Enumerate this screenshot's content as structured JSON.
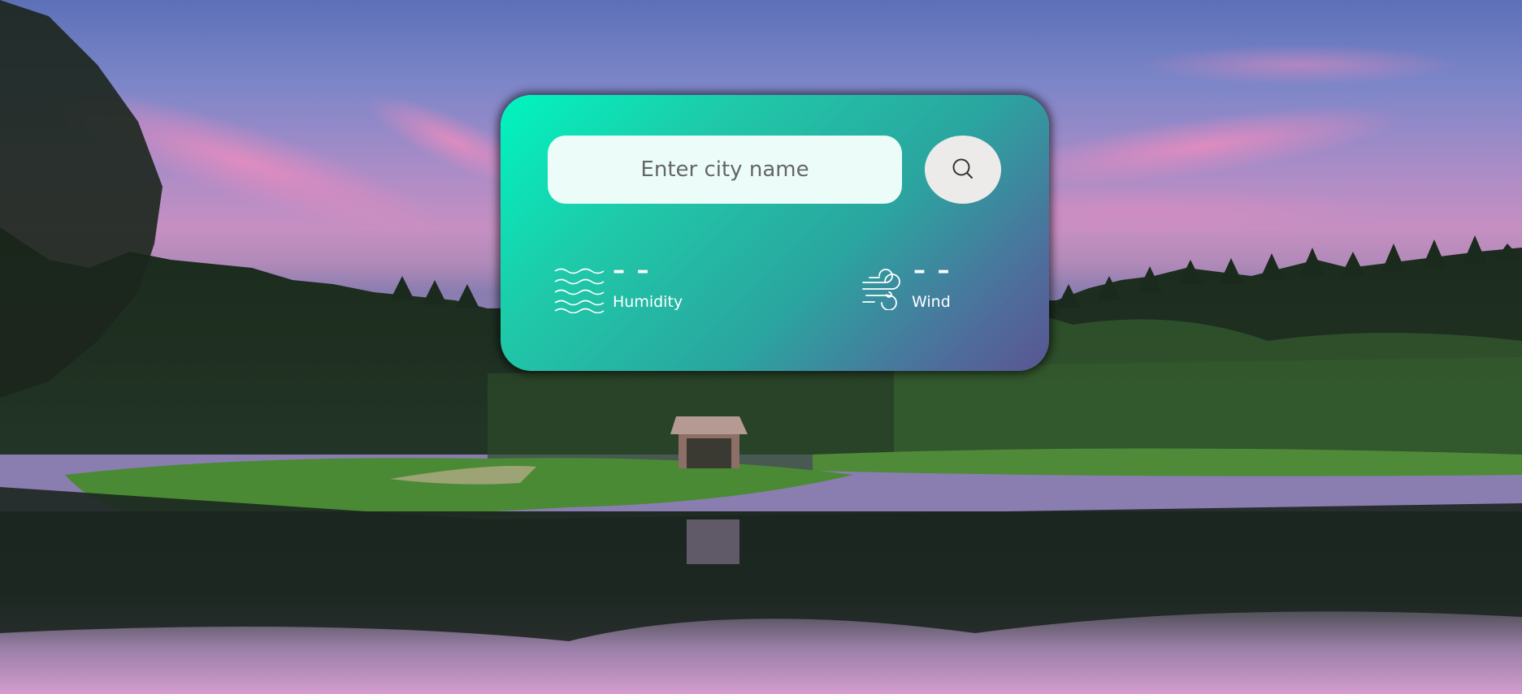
{
  "search": {
    "placeholder": "Enter city name",
    "value": ""
  },
  "search_button": {
    "icon": "search-icon"
  },
  "humidity": {
    "value": "– –",
    "label": "Humidity",
    "icon": "waves-icon"
  },
  "wind": {
    "value": "– –",
    "label": "Wind",
    "icon": "wind-icon"
  },
  "colors": {
    "card_gradient_start": "#00f5c0",
    "card_gradient_end": "#5a5593",
    "input_background": "#ecfdf9",
    "button_background": "#ecebea"
  }
}
